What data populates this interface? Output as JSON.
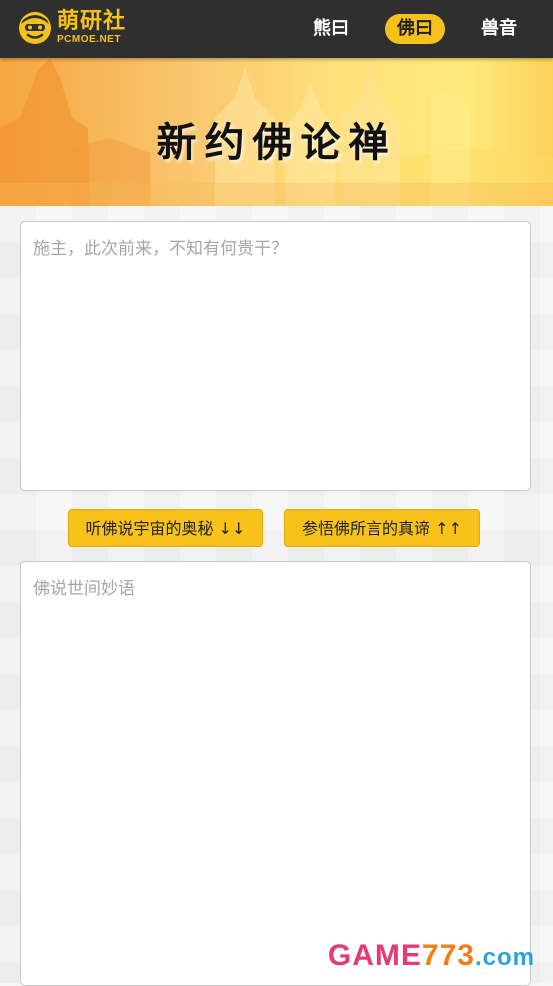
{
  "brand": {
    "name_cn": "萌研社",
    "name_en": "PCMOE.NET",
    "color": "#f5c21b"
  },
  "nav": {
    "items": [
      {
        "label": "熊曰",
        "active": false
      },
      {
        "label": "佛曰",
        "active": true
      },
      {
        "label": "兽音",
        "active": false
      }
    ]
  },
  "banner": {
    "title": "新约佛论禅"
  },
  "input": {
    "placeholder": "施主，此次前来，不知有何贵干？",
    "value": ""
  },
  "buttons": {
    "encode_label": "听佛说宇宙的奥秘 ↓↓",
    "decode_label": "参悟佛所言的真谛 ↑↑",
    "color": "#f7c31a"
  },
  "output": {
    "placeholder": "佛说世间妙语",
    "value": ""
  },
  "watermark": {
    "part1": "GAME",
    "part2": "773",
    "part3": ".com"
  }
}
